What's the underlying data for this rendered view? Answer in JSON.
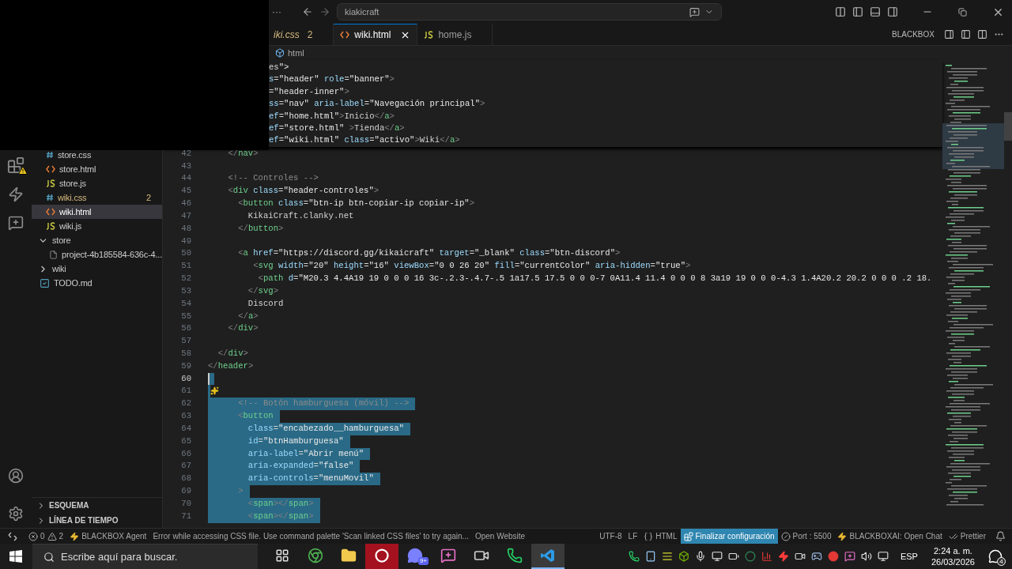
{
  "title_bar": {
    "more": "···",
    "search": "kiakicraft"
  },
  "tabs": [
    {
      "label": "iki.css",
      "preview": true,
      "problems": "2",
      "selected": false
    },
    {
      "label": "wiki.html",
      "kind": "html",
      "preview": false,
      "selected": true
    },
    {
      "label": "home.js",
      "kind": "js",
      "preview": false,
      "selected": false
    }
  ],
  "editor_actions": {
    "label": "BLACKBOX"
  },
  "breadcrumb": "html",
  "sticky_lines": [
    "es\">",
    "s=\"header\" role=\"banner\">",
    "=\"header-inner\">",
    "ss=\"nav\" aria-label=\"Navegación principal\">",
    "ef=\"home.html\">Inicio</a>",
    "ef=\"store.html\" >Tienda</a>",
    "ef=\"wiki.html\" class=\"activo\">Wiki</a>"
  ],
  "code_lines": [
    {
      "n": "42",
      "kind": "code",
      "text": "    </nav>",
      "selected": false,
      "current": false
    },
    {
      "n": "43",
      "kind": "code",
      "selected": false,
      "current": false
    },
    {
      "n": "44",
      "kind": "code",
      "text": "    <!-- Controles -->",
      "selected": false,
      "current": false
    },
    {
      "n": "45",
      "kind": "code",
      "text": "    <div class=\"header-controles\">",
      "selected": false,
      "current": false
    },
    {
      "n": "46",
      "kind": "code",
      "text": "      <button class=\"btn-ip btn-copiar-ip copiar-ip\">",
      "selected": false,
      "current": false
    },
    {
      "n": "47",
      "kind": "code",
      "text": "        KikaiCraft.clanky.net",
      "selected": false,
      "current": false
    },
    {
      "n": "48",
      "kind": "code",
      "text": "      </button>",
      "selected": false,
      "current": false
    },
    {
      "n": "49",
      "kind": "code",
      "selected": false,
      "current": false
    },
    {
      "n": "50",
      "kind": "code",
      "text": "      <a href=\"https://discord.gg/kikaicraft\" target=\"_blank\" class=\"btn-discord\">",
      "selected": false,
      "current": false
    },
    {
      "n": "51",
      "kind": "code",
      "text": "         <svg width=\"20\" height=\"16\" viewBox=\"0 0 26 20\" fill=\"currentColor\" aria-hidden=\"true\">",
      "selected": false,
      "current": false
    },
    {
      "n": "52",
      "kind": "code",
      "text": "          <path d=\"M20.3 4.4A19 19 0 0 0 16 3c-.2.3-.4.7-.5 1a17.5 17.5 0 0 0-7 0A11.4 11.4 0 0 0 8 3a19 19 0 0 0-4.3 1.4A20.2 20.2 0 0 0 .2 18.",
      "selected": false,
      "current": false
    },
    {
      "n": "53",
      "kind": "code",
      "text": "        </svg>",
      "selected": false,
      "current": false
    },
    {
      "n": "54",
      "kind": "code",
      "text": "        Discord",
      "selected": false,
      "current": false
    },
    {
      "n": "55",
      "kind": "code",
      "text": "      </a>",
      "selected": false,
      "current": false
    },
    {
      "n": "56",
      "kind": "code",
      "text": "    </div>",
      "selected": false,
      "current": false
    },
    {
      "n": "57",
      "kind": "code",
      "selected": false,
      "current": false
    },
    {
      "n": "58",
      "kind": "code",
      "text": "  </div>",
      "selected": false,
      "current": false
    },
    {
      "n": "59",
      "kind": "code",
      "text": "</header>",
      "selected": false,
      "current": false
    },
    {
      "n": "60",
      "kind": "code",
      "selected": true,
      "current": true
    },
    {
      "n": "61",
      "kind": "hint",
      "selected": true,
      "current": false
    },
    {
      "n": "62",
      "kind": "code",
      "text": "      <!-- Botón hamburguesa (móvil) -->",
      "selected": true,
      "current": false
    },
    {
      "n": "63",
      "kind": "code",
      "text": "      <button",
      "selected": true,
      "current": false
    },
    {
      "n": "64",
      "kind": "code",
      "text": "        class=\"encabezado__hamburguesa\"",
      "selected": true,
      "current": false
    },
    {
      "n": "65",
      "kind": "code",
      "text": "        id=\"btnHamburguesa\"",
      "selected": true,
      "current": false
    },
    {
      "n": "66",
      "kind": "code",
      "text": "        aria-label=\"Abrir menú\"",
      "selected": true,
      "current": false
    },
    {
      "n": "67",
      "kind": "code",
      "text": "        aria-expanded=\"false\"",
      "selected": true,
      "current": false
    },
    {
      "n": "68",
      "kind": "code",
      "text": "        aria-controls=\"menuMovil\"",
      "selected": true,
      "current": false
    },
    {
      "n": "69",
      "kind": "code",
      "text": "      >",
      "selected": true,
      "current": false
    },
    {
      "n": "70",
      "kind": "code",
      "text": "        <span></span>",
      "selected": true,
      "current": false
    },
    {
      "n": "71",
      "kind": "code",
      "text": "        <span></span>",
      "selected": true,
      "current": false
    }
  ],
  "sidebar": {
    "open_folder_files": [
      {
        "name": "store.css",
        "kind": "css",
        "selected": false
      },
      {
        "name": "store.html",
        "kind": "html",
        "selected": false
      },
      {
        "name": "store.js",
        "kind": "js",
        "selected": false
      },
      {
        "name": "wiki.css",
        "kind": "css",
        "problems": "2",
        "selected": false
      },
      {
        "name": "wiki.html",
        "kind": "html",
        "selected": true
      },
      {
        "name": "wiki.js",
        "kind": "js",
        "selected": false
      }
    ],
    "tree": [
      {
        "name": "store",
        "kind": "folder",
        "expanded": true,
        "selected": false,
        "children": [
          {
            "name": "project-4b185584-636c-4...",
            "kind": "file",
            "selected": false
          }
        ]
      },
      {
        "name": "wiki",
        "kind": "folder",
        "expanded": false,
        "selected": false
      },
      {
        "name": "TODO.md",
        "kind": "todo",
        "selected": false
      }
    ],
    "sections": [
      {
        "label": "ESQUEMA",
        "expanded": false
      },
      {
        "label": "LÍNEA DE TIEMPO",
        "expanded": false
      }
    ]
  },
  "status_bar": {
    "left": [
      {
        "kind": "remote"
      },
      {
        "kind": "problems",
        "errors": "0",
        "warnings": "2"
      },
      {
        "kind": "bolt",
        "label": "BLACKBOX Agent"
      },
      {
        "kind": "text",
        "label": "Error while accessing CSS file. Use command palette 'Scan linked CSS files' to try again..."
      },
      {
        "kind": "text",
        "label": "Open Website"
      }
    ],
    "right": [
      {
        "kind": "text",
        "label": "UTF-8"
      },
      {
        "kind": "text",
        "label": "LF"
      },
      {
        "kind": "braces",
        "label": "HTML"
      },
      {
        "kind": "highlight",
        "label": "Finalizar configuración"
      },
      {
        "kind": "port",
        "label": "Port : 5500"
      },
      {
        "kind": "bolt",
        "label": "BLACKBOXAI: Open Chat"
      },
      {
        "kind": "checks",
        "label": "Prettier"
      },
      {
        "kind": "bell"
      }
    ]
  },
  "taskbar": {
    "search_placeholder": "Escribe aquí para buscar.",
    "apps": [
      {
        "kind": "taskview",
        "active": false
      },
      {
        "kind": "browser",
        "active": false
      },
      {
        "kind": "folder",
        "active": false
      },
      {
        "kind": "red",
        "active": false
      },
      {
        "kind": "game-chat",
        "active": false,
        "badge": "9+"
      },
      {
        "kind": "chat",
        "active": false
      },
      {
        "kind": "recorder",
        "active": false
      },
      {
        "kind": "phone",
        "active": false
      },
      {
        "kind": "code",
        "active": true
      }
    ],
    "tray": [
      {
        "kind": "phone"
      },
      {
        "kind": "tablet"
      },
      {
        "kind": "bars"
      },
      {
        "kind": "gpu"
      },
      {
        "kind": "mic"
      },
      {
        "kind": "screen"
      },
      {
        "kind": "battery"
      },
      {
        "kind": "ring"
      },
      {
        "kind": "audio"
      },
      {
        "kind": "bolt"
      },
      {
        "kind": "recorder"
      },
      {
        "kind": "gamepad"
      },
      {
        "kind": "red"
      },
      {
        "kind": "chat"
      },
      {
        "kind": "volume"
      },
      {
        "kind": "monitor"
      }
    ],
    "language": "ESP",
    "time": "2:24 a. m.",
    "date": "26/03/2026",
    "notifications": "4"
  }
}
